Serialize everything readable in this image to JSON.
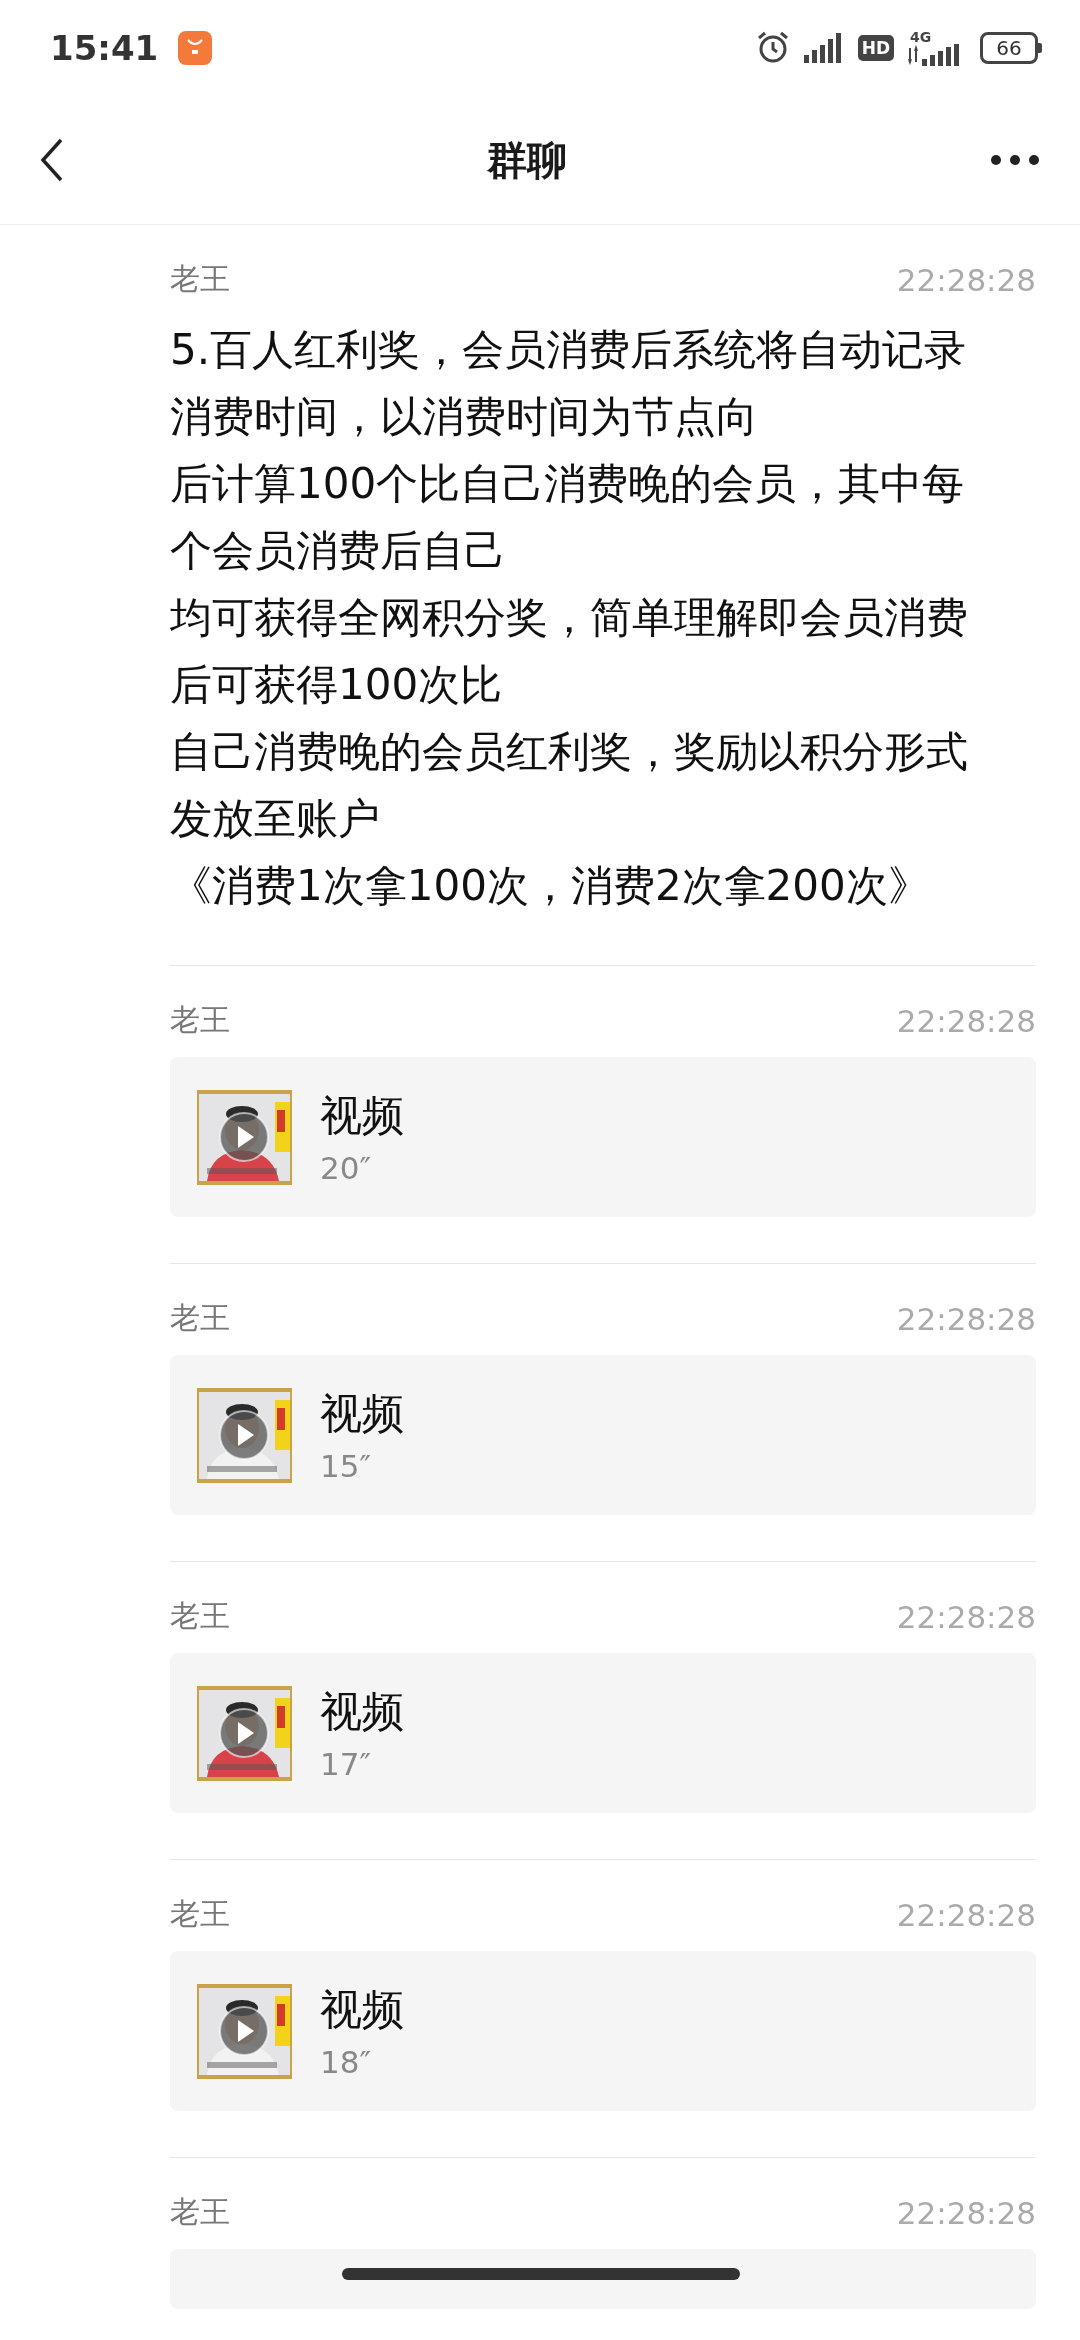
{
  "status_bar": {
    "time": "15:41",
    "hd": "HD",
    "network": "4G",
    "battery": "66"
  },
  "header": {
    "title": "群聊"
  },
  "messages": [
    {
      "kind": "text",
      "sender": "老王",
      "time": "22:28:28",
      "lines": [
        "5.百人红利奖，会员消费后系统将自动记录",
        "消费时间，以消费时间为节点向",
        "后计算100个比自己消费晚的会员，其中每",
        "个会员消费后自己",
        "均可获得全网积分奖，简单理解即会员消费",
        "后可获得100次比",
        "自己消费晚的会员红利奖，奖励以积分形式",
        "发放至账户",
        "《消费1次拿100次，消费2次拿200次》"
      ]
    },
    {
      "kind": "video",
      "sender": "老王",
      "time": "22:28:28",
      "title": "视频",
      "duration": "20″"
    },
    {
      "kind": "video",
      "sender": "老王",
      "time": "22:28:28",
      "title": "视频",
      "duration": "15″"
    },
    {
      "kind": "video",
      "sender": "老王",
      "time": "22:28:28",
      "title": "视频",
      "duration": "17″"
    },
    {
      "kind": "video",
      "sender": "老王",
      "time": "22:28:28",
      "title": "视频",
      "duration": "18″"
    },
    {
      "kind": "cut",
      "sender": "老王",
      "time": "22:28:28"
    }
  ]
}
